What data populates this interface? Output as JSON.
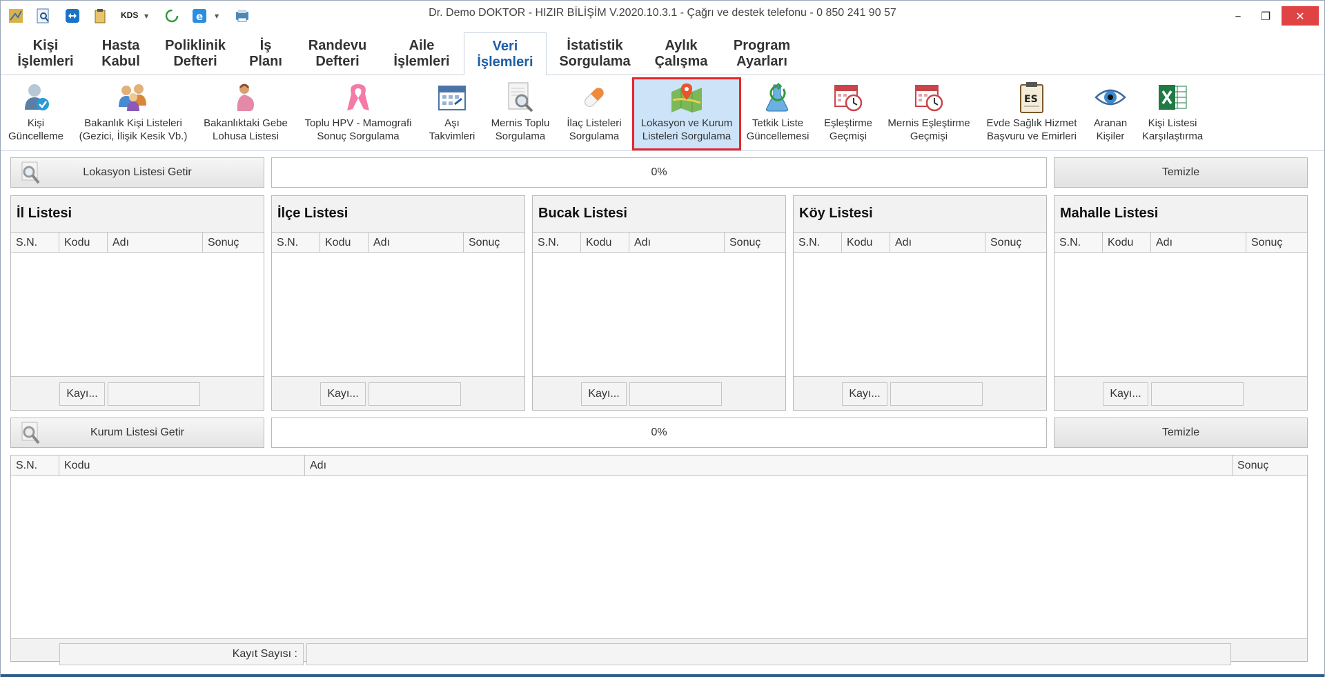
{
  "window": {
    "title": "Dr. Demo DOKTOR - HIZIR BİLİŞİM V.2020.10.3.1 - Çağrı ve destek telefonu - 0 850 241 90 57",
    "kds_label": "KDS",
    "minimize_glyph": "–",
    "restore_glyph": "❐",
    "close_glyph": "✕",
    "close_color": "#e04343"
  },
  "tabs": [
    {
      "line1": "Kişi",
      "line2": "İşlemleri"
    },
    {
      "line1": "Hasta",
      "line2": "Kabul"
    },
    {
      "line1": "Poliklinik",
      "line2": "Defteri"
    },
    {
      "line1": "İş",
      "line2": "Planı"
    },
    {
      "line1": "Randevu",
      "line2": "Defteri"
    },
    {
      "line1": "Aile",
      "line2": "İşlemleri"
    },
    {
      "line1": "Veri",
      "line2": "İşlemleri",
      "active": true
    },
    {
      "line1": "İstatistik",
      "line2": "Sorgulama"
    },
    {
      "line1": "Aylık",
      "line2": "Çalışma"
    },
    {
      "line1": "Program",
      "line2": "Ayarları"
    }
  ],
  "ribbon": [
    {
      "line1": "Kişi",
      "line2": "Güncelleme",
      "icon": "person-update-icon"
    },
    {
      "line1": "Bakanlık Kişi Listeleri",
      "line2": "(Gezici, İlişik Kesik Vb.)",
      "icon": "people-group-icon"
    },
    {
      "line1": "Bakanlıktaki Gebe",
      "line2": "Lohusa Listesi",
      "icon": "pregnant-woman-icon"
    },
    {
      "line1": "Toplu HPV - Mamografi",
      "line2": "Sonuç Sorgulama",
      "icon": "pink-ribbon-icon"
    },
    {
      "line1": "Aşı",
      "line2": "Takvimleri",
      "icon": "calendar-icon"
    },
    {
      "line1": "Mernis Toplu",
      "line2": "Sorgulama",
      "icon": "document-search-icon"
    },
    {
      "line1": "İlaç Listeleri",
      "line2": "Sorgulama",
      "icon": "pill-icon"
    },
    {
      "line1": "Lokasyon ve Kurum",
      "line2": "Listeleri Sorgulama",
      "icon": "map-pin-icon",
      "selected": true
    },
    {
      "line1": "Tetkik Liste",
      "line2": "Güncellemesi",
      "icon": "flask-refresh-icon"
    },
    {
      "line1": "Eşleştirme",
      "line2": "Geçmişi",
      "icon": "calendar-clock-icon"
    },
    {
      "line1": "Mernis Eşleştirme",
      "line2": "Geçmişi",
      "icon": "calendar-clock-icon"
    },
    {
      "line1": "Evde Sağlık Hizmet",
      "line2": "Başvuru ve Emirleri",
      "icon": "clipboard-es-icon"
    },
    {
      "line1": "Aranan",
      "line2": "Kişiler",
      "icon": "eye-icon"
    },
    {
      "line1": "Kişi Listesi",
      "line2": "Karşılaştırma",
      "icon": "excel-icon"
    }
  ],
  "lokasyon": {
    "get_button": "Lokasyon Listesi Getir",
    "progress": "0%",
    "clear_button": "Temizle"
  },
  "panels": [
    {
      "title": "İl Listesi"
    },
    {
      "title": "İlçe Listesi"
    },
    {
      "title": "Bucak Listesi"
    },
    {
      "title": "Köy Listesi"
    },
    {
      "title": "Mahalle Listesi"
    }
  ],
  "panel_columns": [
    "S.N.",
    "Kodu",
    "Adı",
    "Sonuç"
  ],
  "panel_footer_button": "Kayı...",
  "kurum": {
    "get_button": "Kurum Listesi Getir",
    "progress": "0%",
    "clear_button": "Temizle",
    "columns": [
      "S.N.",
      "Kodu",
      "Adı",
      "Sonuç"
    ],
    "record_count_label": "Kayıt Sayısı :"
  }
}
